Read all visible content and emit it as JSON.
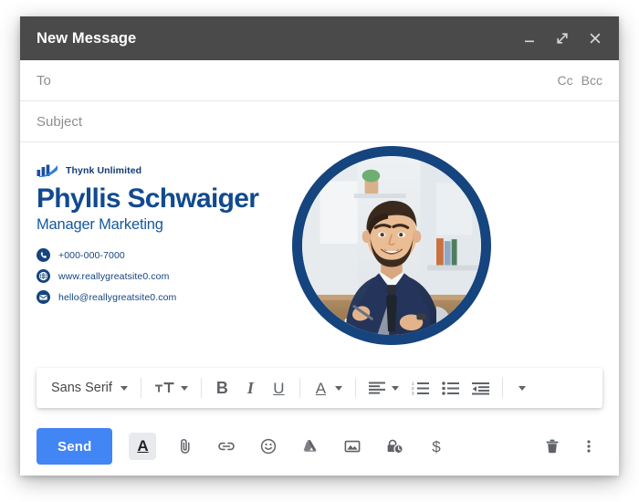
{
  "window": {
    "title": "New Message",
    "controls": [
      {
        "name": "minimize",
        "glyph": "minimize-icon"
      },
      {
        "name": "expand",
        "glyph": "expand-icon"
      },
      {
        "name": "close",
        "glyph": "close-icon"
      }
    ]
  },
  "fields": {
    "to": {
      "label": "To",
      "value": "",
      "placeholder": "To"
    },
    "subject": {
      "label": "Subject",
      "value": "",
      "placeholder": "Subject"
    },
    "cc": "Cc",
    "bcc": "Bcc"
  },
  "signature": {
    "brand": "Thynk Unlimited",
    "name": "Phyllis Schwaiger",
    "role": "Manager Marketing",
    "contacts": [
      {
        "icon": "phone-icon",
        "text": "+000-000-7000"
      },
      {
        "icon": "globe-icon",
        "text": "www.reallygreatsite0.com"
      },
      {
        "icon": "envelope-icon",
        "text": "hello@reallygreatsite0.com"
      }
    ],
    "portrait_alt": "businessman-portrait"
  },
  "format_toolbar": {
    "font": "Sans Serif",
    "items": [
      {
        "name": "font-select",
        "label": "Sans Serif"
      },
      {
        "name": "font-size",
        "label": "TT"
      },
      {
        "name": "bold",
        "label": "B"
      },
      {
        "name": "italic",
        "label": "I"
      },
      {
        "name": "underline",
        "label": "U"
      },
      {
        "name": "text-color",
        "label": "A"
      },
      {
        "name": "align",
        "label": "align"
      },
      {
        "name": "numbered-list",
        "label": "1."
      },
      {
        "name": "bulleted-list",
        "label": "•"
      },
      {
        "name": "indent-less",
        "label": "indent"
      },
      {
        "name": "more-format",
        "label": "more"
      }
    ]
  },
  "actions": {
    "send_label": "Send",
    "icons": [
      {
        "name": "formatting-options-icon",
        "active": true
      },
      {
        "name": "attach-file-icon",
        "active": false
      },
      {
        "name": "insert-link-icon",
        "active": false
      },
      {
        "name": "insert-emoji-icon",
        "active": false
      },
      {
        "name": "google-drive-icon",
        "active": false
      },
      {
        "name": "insert-photo-icon",
        "active": false
      },
      {
        "name": "confidential-mode-icon",
        "active": false
      },
      {
        "name": "insert-money-icon",
        "active": false
      }
    ],
    "right_icons": [
      {
        "name": "discard-draft-icon"
      },
      {
        "name": "more-options-icon"
      }
    ]
  },
  "colors": {
    "titlebar": "#4a4a4a",
    "send_blue": "#4285f4",
    "brand_navy": "#15447e",
    "name_blue": "#114a8f",
    "icon_gray": "#5f6368"
  }
}
